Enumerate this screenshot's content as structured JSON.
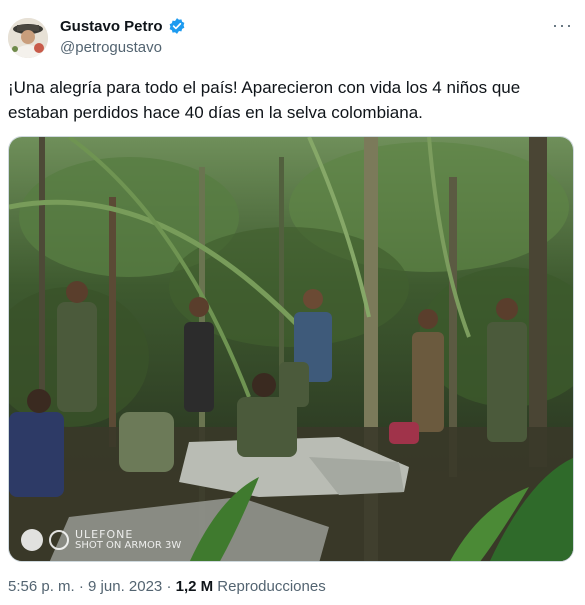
{
  "user": {
    "display_name": "Gustavo Petro",
    "handle": "@petrogustavo",
    "verified_icon": "verified-badge-icon",
    "verified_color": "#1d9bf0"
  },
  "menu": {
    "more_label": "···"
  },
  "tweet": {
    "text": "¡Una alegría para todo el país! Aparecieron con vida los 4 niños que estaban perdidos hace 40 días en la selva colombiana."
  },
  "photo": {
    "watermark_brand": "ULEFONE",
    "watermark_caption": "SHOT ON ARMOR 3W"
  },
  "meta": {
    "time": "5:56 p. m.",
    "separator1": " · ",
    "date": "9 jun. 2023",
    "separator2": " · ",
    "views_count": "1,2 M",
    "views_label": " Reproducciones"
  }
}
